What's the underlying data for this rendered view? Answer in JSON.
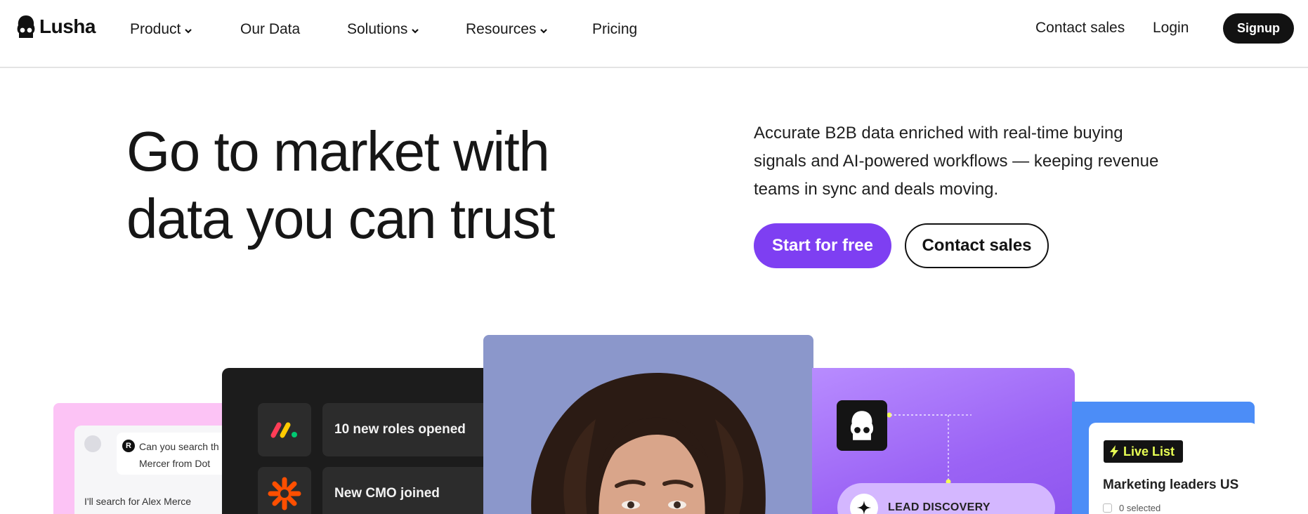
{
  "nav": {
    "logo_text": "Lusha",
    "links": {
      "product": "Product",
      "our_data": "Our Data",
      "solutions": "Solutions",
      "resources": "Resources",
      "pricing": "Pricing"
    },
    "contact_sales": "Contact sales",
    "login": "Login",
    "signup": "Signup"
  },
  "hero": {
    "headline_line1": "Go to market with",
    "headline_line2": "data you can trust",
    "description": "Accurate B2B data enriched with real-time buying signals and AI-powered workflows — keeping revenue teams in sync and deals moving.",
    "primary_cta": "Start for free",
    "secondary_cta": "Contact sales"
  },
  "cards": {
    "chat": {
      "avatar_letter": "R",
      "question": "Can you search th",
      "question_line2": "Mercer from Dot",
      "reply": "I'll search for Alex Merce"
    },
    "signals": {
      "items": [
        {
          "text": "10 new roles opened",
          "icon": "monday-logo-icon"
        },
        {
          "text": "New CMO joined",
          "icon": "zapier-logo-icon"
        }
      ]
    },
    "lead_discovery": {
      "label": "LEAD DISCOVERY",
      "icon": "sparkle-icon"
    },
    "live_list": {
      "badge": "Live List",
      "title": "Marketing leaders US",
      "selected": "0 selected"
    }
  },
  "colors": {
    "brand_purple": "#7e3ff2",
    "nav_dark": "#121212",
    "card_pink": "#fcc3f5",
    "card_dark": "#1c1c1c",
    "card_photo_bg": "#8b97cb",
    "card_purple": "#9b63f5",
    "card_blue": "#4c8df7",
    "live_badge_text": "#e8ff54"
  }
}
